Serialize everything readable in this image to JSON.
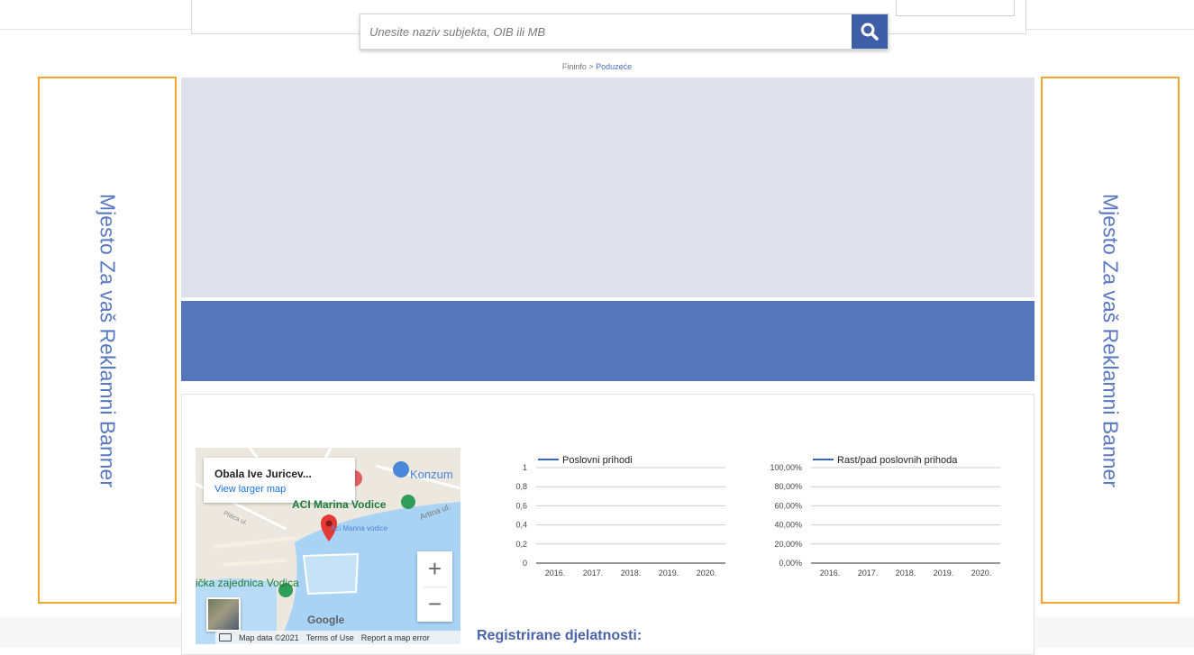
{
  "search": {
    "placeholder": "Unesite naziv subjekta, OIB ili MB"
  },
  "breadcrumb": {
    "home": "Fininfo",
    "separator": ">",
    "current": "Poduzeće"
  },
  "banners": {
    "left_text": "Mjesto Za vaš Reklamni Banner",
    "right_text": "Mjesto Za vaš Reklamni Banner"
  },
  "map": {
    "place_title": "Obala Ive Juricev...",
    "larger_map_link": "View larger map",
    "labels": {
      "konzum": "Konzum",
      "marina": "ACI Marina Vodice",
      "aci": "Aci Marina vodice",
      "artina": "Artina ul.",
      "plitica": "Plitica ul.",
      "zajednica": "ička zajednica Vodica",
      "google": "Google"
    },
    "footer": {
      "data": "Map data ©2021",
      "terms": "Terms of Use",
      "report": "Report a map error"
    },
    "zoom_in": "+",
    "zoom_out": "−"
  },
  "section": {
    "registered_heading": "Registrirane djelatnosti:"
  },
  "chart_data": [
    {
      "type": "line",
      "series": [
        {
          "name": "Poslovni prihodi",
          "values": []
        }
      ],
      "categories": [
        "2016.",
        "2017.",
        "2018.",
        "2019.",
        "2020."
      ],
      "ytick_labels": [
        "0",
        "0,2",
        "0,4",
        "0,6",
        "0,8",
        "1"
      ],
      "ylim": [
        0,
        1
      ],
      "legend": "top",
      "grid": true,
      "color": "#3366cc"
    },
    {
      "type": "line",
      "series": [
        {
          "name": "Rast/pad poslovnih prihoda",
          "values": []
        }
      ],
      "categories": [
        "2016.",
        "2017.",
        "2018.",
        "2019.",
        "2020."
      ],
      "ytick_labels": [
        "0,00%",
        "20,00%",
        "40,00%",
        "60,00%",
        "80,00%",
        "100,00%"
      ],
      "ylim": [
        0,
        100
      ],
      "legend": "top",
      "grid": true,
      "color": "#3366cc"
    }
  ]
}
